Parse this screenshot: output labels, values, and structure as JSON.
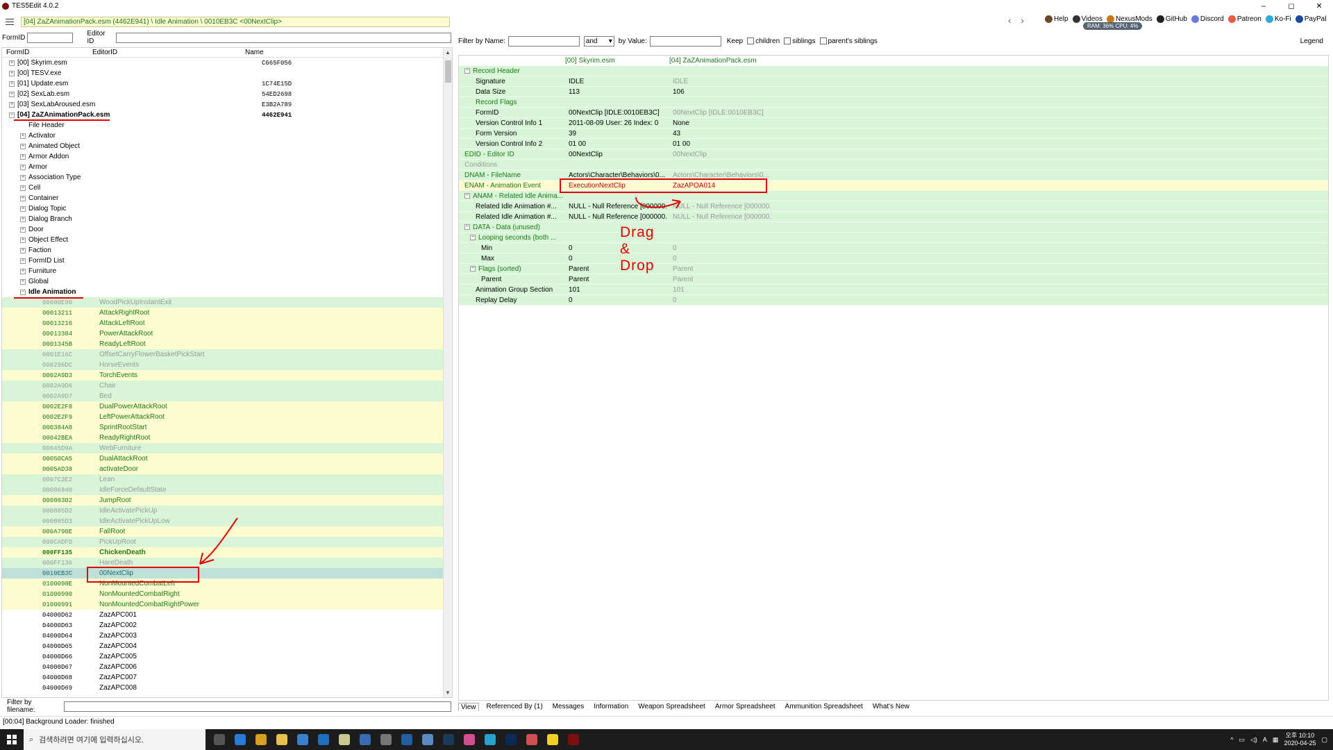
{
  "window": {
    "title": "TES5Edit 4.0.2",
    "controls": [
      "–",
      "◻",
      "✕"
    ]
  },
  "toolbar": {
    "path": "[04] ZaZAnimationPack.esm (4462E941) \\ Idle Animation \\ 0010EB3C <00NextClip>",
    "nav_back": "‹",
    "nav_forward": "›",
    "links": [
      {
        "label": "Help",
        "icon": "book-icon",
        "color": "#6b4a2a"
      },
      {
        "label": "Videos",
        "icon": "video-icon",
        "color": "#333333"
      },
      {
        "label": "NexusMods",
        "icon": "nexus-icon",
        "color": "#c87a1a"
      },
      {
        "label": "GitHub",
        "icon": "github-icon",
        "color": "#222222"
      },
      {
        "label": "Discord",
        "icon": "discord-icon",
        "color": "#6a7adb"
      },
      {
        "label": "Patreon",
        "icon": "patreon-icon",
        "color": "#e85b46"
      },
      {
        "label": "Ko-Fi",
        "icon": "kofi-icon",
        "color": "#29abe0"
      },
      {
        "label": "PayPal",
        "icon": "paypal-icon",
        "color": "#1a4aa0"
      }
    ],
    "ram": "RAM: 36%  CPU: 4%"
  },
  "left": {
    "formid_label": "FormID",
    "editorid_label": "Editor ID",
    "columns": [
      "FormID",
      "EditorID",
      "Name"
    ],
    "filter_filename_label": "Filter by filename:",
    "plugins": [
      {
        "label": "[00] Skyrim.esm",
        "name": "C665F056"
      },
      {
        "label": "[00] TESV.exe",
        "name": ""
      },
      {
        "label": "[01] Update.esm",
        "name": "1C74E15D"
      },
      {
        "label": "[02] SexLab.esm",
        "name": "54ED2698"
      },
      {
        "label": "[03] SexLabAroused.esm",
        "name": "E3B2A789"
      },
      {
        "label": "[04] ZaZAnimationPack.esm",
        "name": "4462E941"
      }
    ],
    "groups": [
      "File Header",
      "Activator",
      "Animated Object",
      "Armor Addon",
      "Armor",
      "Association Type",
      "Cell",
      "Container",
      "Dialog Topic",
      "Dialog Branch",
      "Door",
      "Object Effect",
      "Faction",
      "FormID List",
      "Furniture",
      "Global"
    ],
    "open_group": "Idle Animation",
    "records": [
      {
        "fid": "00000E90",
        "eid": "WoodPickUpInstantExit",
        "style": "gray"
      },
      {
        "fid": "00013211",
        "eid": "AttackRightRoot",
        "style": "green"
      },
      {
        "fid": "00013216",
        "eid": "AttackLeftRoot",
        "style": "green"
      },
      {
        "fid": "00013384",
        "eid": "PowerAttackRoot",
        "style": "green"
      },
      {
        "fid": "0001345B",
        "eid": "ReadyLeftRoot",
        "style": "green"
      },
      {
        "fid": "0001E16C",
        "eid": "OffsetCarryFlowerBasketPickStart",
        "style": "gray"
      },
      {
        "fid": "000296DC",
        "eid": "HorseEvents",
        "style": "gray"
      },
      {
        "fid": "0002A9D3",
        "eid": "TorchEvents",
        "style": "green"
      },
      {
        "fid": "0002A9D6",
        "eid": "Chair",
        "style": "gray"
      },
      {
        "fid": "0002A9D7",
        "eid": "Bed",
        "style": "gray"
      },
      {
        "fid": "0002E2F8",
        "eid": "DualPowerAttackRoot",
        "style": "green"
      },
      {
        "fid": "0002E2F9",
        "eid": "LeftPowerAttackRoot",
        "style": "green"
      },
      {
        "fid": "000384A8",
        "eid": "SprintRootStart",
        "style": "green"
      },
      {
        "fid": "00042BEA",
        "eid": "ReadyRightRoot",
        "style": "green"
      },
      {
        "fid": "00045D9A",
        "eid": "WebFurniture",
        "style": "gray"
      },
      {
        "fid": "00050CA5",
        "eid": "DualAttackRoot",
        "style": "green"
      },
      {
        "fid": "0005AD38",
        "eid": "activateDoor",
        "style": "green"
      },
      {
        "fid": "0007C3E2",
        "eid": "Lean",
        "style": "gray"
      },
      {
        "fid": "00086840",
        "eid": "IdleForceDefaultState",
        "style": "gray"
      },
      {
        "fid": "00088302",
        "eid": "JumpRoot",
        "style": "green"
      },
      {
        "fid": "000885D2",
        "eid": "IdleActivatePickUp",
        "style": "gray"
      },
      {
        "fid": "000885D3",
        "eid": "IdleActivatePickUpLow",
        "style": "gray"
      },
      {
        "fid": "000A790E",
        "eid": "FallRoot",
        "style": "green"
      },
      {
        "fid": "000CADFD",
        "eid": "PickUpRoot",
        "style": "gray"
      },
      {
        "fid": "000FF135",
        "eid": "ChickenDeath",
        "style": "greenbold"
      },
      {
        "fid": "000FF136",
        "eid": "HareDeath",
        "style": "gray"
      },
      {
        "fid": "0010EB3C",
        "eid": "00NextClip",
        "style": "selected"
      },
      {
        "fid": "0100098E",
        "eid": "NonMountedCombatLeft",
        "style": "green"
      },
      {
        "fid": "01000990",
        "eid": "NonMountedCombatRight",
        "style": "green"
      },
      {
        "fid": "01000991",
        "eid": "NonMountedCombatRightPower",
        "style": "green"
      },
      {
        "fid": "04000D62",
        "eid": "ZazAPC001",
        "style": "plain"
      },
      {
        "fid": "04000D63",
        "eid": "ZazAPC002",
        "style": "plain"
      },
      {
        "fid": "04000D64",
        "eid": "ZazAPC003",
        "style": "plain"
      },
      {
        "fid": "04000D65",
        "eid": "ZazAPC004",
        "style": "plain"
      },
      {
        "fid": "04000D66",
        "eid": "ZazAPC005",
        "style": "plain"
      },
      {
        "fid": "04000D67",
        "eid": "ZazAPC006",
        "style": "plain"
      },
      {
        "fid": "04000D68",
        "eid": "ZazAPC007",
        "style": "plain"
      },
      {
        "fid": "04000D69",
        "eid": "ZazAPC008",
        "style": "plain"
      }
    ]
  },
  "right": {
    "filter_name_label": "Filter by Name:",
    "and_value": "and",
    "by_value_label": "by Value:",
    "keep_label": "Keep",
    "children_label": "children",
    "siblings_label": "siblings",
    "parents_siblings_label": "parent's siblings",
    "legend_label": "Legend",
    "col1": "[00] Skyrim.esm",
    "col2": "[04] ZaZAnimationPack.esm",
    "rows": [
      {
        "label": "Record Header",
        "v1": "",
        "v2": "",
        "indent": 1,
        "exp": "⊟",
        "style": "cl"
      },
      {
        "label": "Signature",
        "v1": "IDLE",
        "v2": "IDLE",
        "indent": 3,
        "v2gray": true
      },
      {
        "label": "Data Size",
        "v1": "113",
        "v2": "106",
        "indent": 3
      },
      {
        "label": "Record Flags",
        "v1": "",
        "v2": "",
        "indent": 3,
        "style": "cl"
      },
      {
        "label": "FormID",
        "v1": "00NextClip [IDLE:0010EB3C]",
        "v2": "00NextClip [IDLE:0010EB3C]",
        "indent": 3,
        "v2gray": true
      },
      {
        "label": "Version Control Info 1",
        "v1": "2011-08-09 User: 26 Index: 0",
        "v2": "None",
        "indent": 3
      },
      {
        "label": "Form Version",
        "v1": "39",
        "v2": "43",
        "indent": 3
      },
      {
        "label": "Version Control Info 2",
        "v1": "01 00",
        "v2": "01 00",
        "indent": 3
      },
      {
        "label": "EDID - Editor ID",
        "v1": "00NextClip",
        "v2": "00NextClip",
        "indent": 1,
        "style": "cl",
        "v2gray": true
      },
      {
        "label": "Conditions",
        "v1": "",
        "v2": "",
        "indent": 1,
        "style": "gray"
      },
      {
        "label": "DNAM - FileName",
        "v1": "Actors\\Character\\Behaviors\\0...",
        "v2": "Actors\\Character\\Behaviors\\0...",
        "indent": 1,
        "style": "cl",
        "v2gray": true
      },
      {
        "label": "ENAM - Animation Event",
        "v1": "ExecutionNextClip",
        "v2": "ZazAPOA014",
        "indent": 1,
        "style": "cl",
        "yellow": true,
        "v1red": true,
        "v2red": true
      },
      {
        "label": "ANAM - Related Idle Anima...",
        "v1": "",
        "v2": "",
        "indent": 1,
        "exp": "⊟",
        "style": "cl"
      },
      {
        "label": "Related Idle Animation #...",
        "v1": "NULL - Null Reference [000000...",
        "v2": "NULL - Null Reference [000000...",
        "indent": 3,
        "v2gray": true
      },
      {
        "label": "Related Idle Animation #...",
        "v1": "NULL - Null Reference [000000...",
        "v2": "NULL - Null Reference [000000...",
        "indent": 3,
        "v2gray": true
      },
      {
        "label": "DATA - Data (unused)",
        "v1": "",
        "v2": "",
        "indent": 1,
        "exp": "⊟",
        "style": "cl"
      },
      {
        "label": "Looping seconds (both ...",
        "v1": "",
        "v2": "",
        "indent": 2,
        "exp": "⊟",
        "style": "cl"
      },
      {
        "label": "Min",
        "v1": "0",
        "v2": "0",
        "indent": 4,
        "v2gray": true
      },
      {
        "label": "Max",
        "v1": "0",
        "v2": "0",
        "indent": 4,
        "v2gray": true
      },
      {
        "label": "Flags (sorted)",
        "v1": "Parent",
        "v2": "Parent",
        "indent": 2,
        "exp": "⊟",
        "style": "cl",
        "v2gray": true
      },
      {
        "label": "Parent",
        "v1": "Parent",
        "v2": "Parent",
        "indent": 4,
        "v2gray": true
      },
      {
        "label": "Animation Group Section",
        "v1": "101",
        "v2": "101",
        "indent": 3,
        "v2gray": true
      },
      {
        "label": "Replay Delay",
        "v1": "0",
        "v2": "0",
        "indent": 3,
        "v2gray": true
      }
    ],
    "tabs": [
      "View",
      "Referenced By (1)",
      "Messages",
      "Information",
      "Weapon Spreadsheet",
      "Armor Spreadsheet",
      "Ammunition Spreadsheet",
      "What's New"
    ]
  },
  "status": "[00:04] Background Loader: finished",
  "annotation": {
    "drag_text": "Drag &  Drop"
  },
  "taskbar": {
    "search_placeholder": "검색하려면 여기에 입력하십시오.",
    "time": "오후 10:10",
    "date": "2020-04-25",
    "ime": "A"
  }
}
